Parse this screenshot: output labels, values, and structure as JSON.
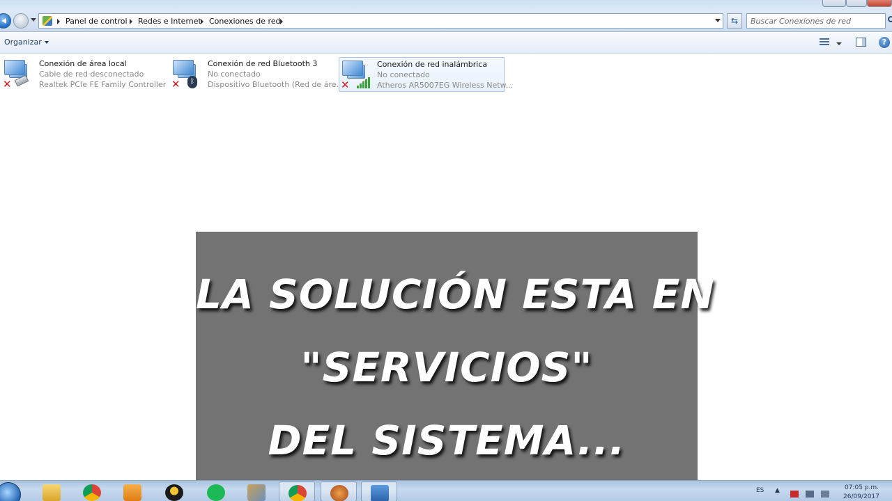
{
  "address_bar": {
    "breadcrumbs": [
      "Panel de control",
      "Redes e Internet",
      "Conexiones de red"
    ],
    "search_placeholder": "Buscar Conexiones de red"
  },
  "command_bar": {
    "organize_label": "Organizar"
  },
  "connections": [
    {
      "name": "Conexión de área local",
      "status": "Cable de red desconectado",
      "adapter": "Realtek PCIe FE Family Controller",
      "type_icon": "ethernet-cable-icon"
    },
    {
      "name": "Conexión de red Bluetooth 3",
      "status": "No conectado",
      "adapter": "Dispositivo Bluetooth (Red de áre...",
      "type_icon": "bluetooth-icon"
    },
    {
      "name": "Conexión de red inalámbrica",
      "status": "No conectado",
      "adapter": "Atheros AR5007EG Wireless Netw...",
      "type_icon": "wifi-signal-icon"
    }
  ],
  "overlay": {
    "lines": [
      "LA SOLUCIÓN ESTA EN",
      "\"SERVICIOS\"",
      "DEL SISTEMA..."
    ]
  },
  "taskbar": {
    "apps": [
      "explorer-icon",
      "chrome-icon",
      "media-player-icon",
      "penguin-app-icon",
      "spotify-icon",
      "network-tool-icon",
      "chrome-icon",
      "game-app-icon",
      "control-panel-icon"
    ],
    "language": "ES",
    "time": "07:05 p.m.",
    "date": "26/09/2017"
  },
  "colors": {
    "overlay_bg": "#737373",
    "error_x": "#d31a1a",
    "signal_green": "#3aa13a"
  }
}
